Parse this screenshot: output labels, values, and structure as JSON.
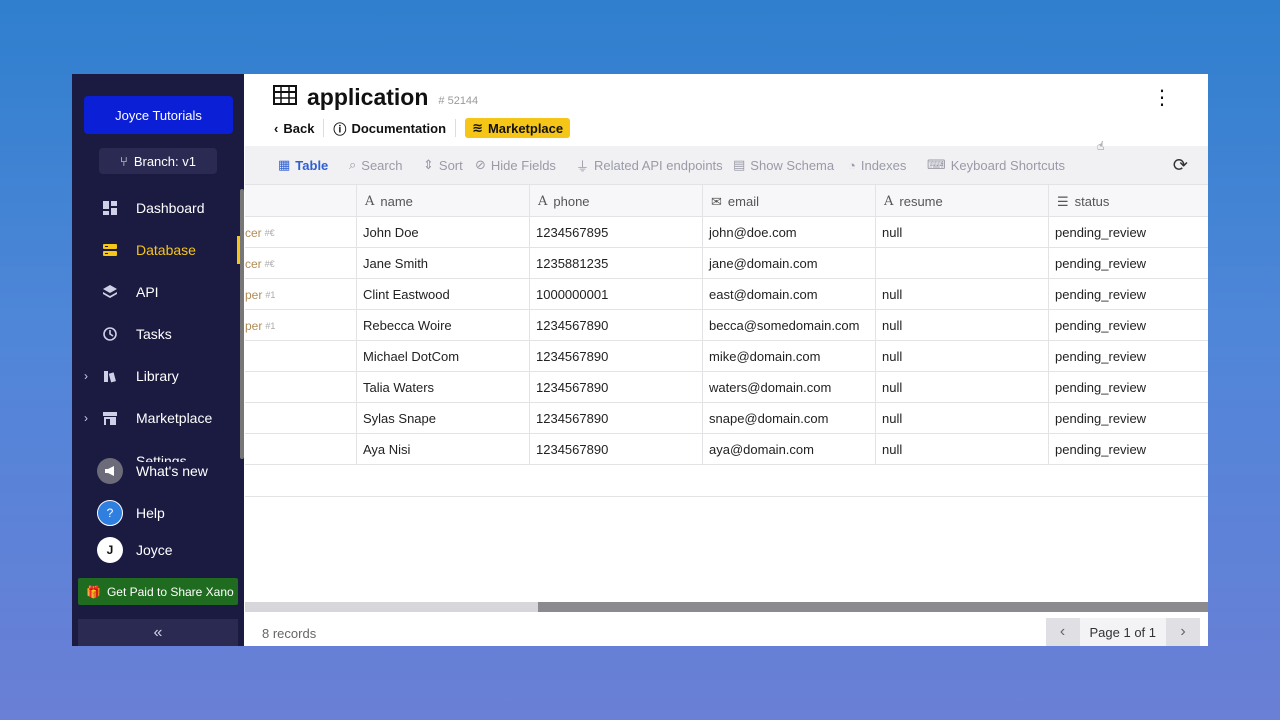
{
  "sidebar": {
    "workspace": "Joyce Tutorials",
    "branch": "Branch: v1",
    "items": [
      {
        "label": "Dashboard",
        "icon": "dashboard-icon",
        "active": false
      },
      {
        "label": "Database",
        "icon": "database-icon",
        "active": true
      },
      {
        "label": "API",
        "icon": "api-icon",
        "active": false
      },
      {
        "label": "Tasks",
        "icon": "history-icon",
        "active": false
      },
      {
        "label": "Library",
        "icon": "library-icon",
        "active": false,
        "expandable": true
      },
      {
        "label": "Marketplace",
        "icon": "store-icon",
        "active": false,
        "expandable": true
      },
      {
        "label": "Settings",
        "icon": "settings-icon",
        "active": false
      }
    ],
    "whats_new": "What's new",
    "help": "Help",
    "user": "Joyce",
    "user_initial": "J",
    "promo": "Get Paid to Share Xano",
    "accent_color": "#f5c518"
  },
  "header": {
    "title": "application",
    "table_id": "# 52144",
    "crumbs": {
      "back": "Back",
      "documentation": "Documentation",
      "marketplace": "Marketplace"
    }
  },
  "toolbar": {
    "table": "Table",
    "search": "Search",
    "sort": "Sort",
    "hide_fields": "Hide Fields",
    "related": "Related API endpoints",
    "schema": "Show Schema",
    "indexes": "Indexes",
    "shortcuts": "Keyboard Shortcuts"
  },
  "table": {
    "columns": [
      "name",
      "phone",
      "email",
      "resume",
      "status"
    ],
    "rows": [
      {
        "prefix": "cer",
        "prefix_id": "#€",
        "name": "John Doe",
        "phone": "1234567895",
        "email": "john@doe.com",
        "resume": "null",
        "status": "pending_review"
      },
      {
        "prefix": "cer",
        "prefix_id": "#€",
        "name": "Jane Smith",
        "phone": "1235881235",
        "email": "jane@domain.com",
        "resume": "",
        "status": "pending_review"
      },
      {
        "prefix": "per",
        "prefix_id": "#1",
        "name": "Clint Eastwood",
        "phone": "1000000001",
        "email": "east@domain.com",
        "resume": "null",
        "status": "pending_review"
      },
      {
        "prefix": "per",
        "prefix_id": "#1",
        "name": "Rebecca Woire",
        "phone": "1234567890",
        "email": "becca@somedomain.com",
        "resume": "null",
        "status": "pending_review"
      },
      {
        "prefix": "",
        "prefix_id": "",
        "name": "Michael DotCom",
        "phone": "1234567890",
        "email": "mike@domain.com",
        "resume": "null",
        "status": "pending_review"
      },
      {
        "prefix": "",
        "prefix_id": "",
        "name": "Talia Waters",
        "phone": "1234567890",
        "email": "waters@domain.com",
        "resume": "null",
        "status": "pending_review"
      },
      {
        "prefix": "",
        "prefix_id": "",
        "name": "Sylas Snape",
        "phone": "1234567890",
        "email": "snape@domain.com",
        "resume": "null",
        "status": "pending_review"
      },
      {
        "prefix": "",
        "prefix_id": "",
        "name": "Aya Nisi",
        "phone": "1234567890",
        "email": "aya@domain.com",
        "resume": "null",
        "status": "pending_review"
      }
    ]
  },
  "footer": {
    "records": "8 records",
    "page": "Page 1 of 1"
  }
}
